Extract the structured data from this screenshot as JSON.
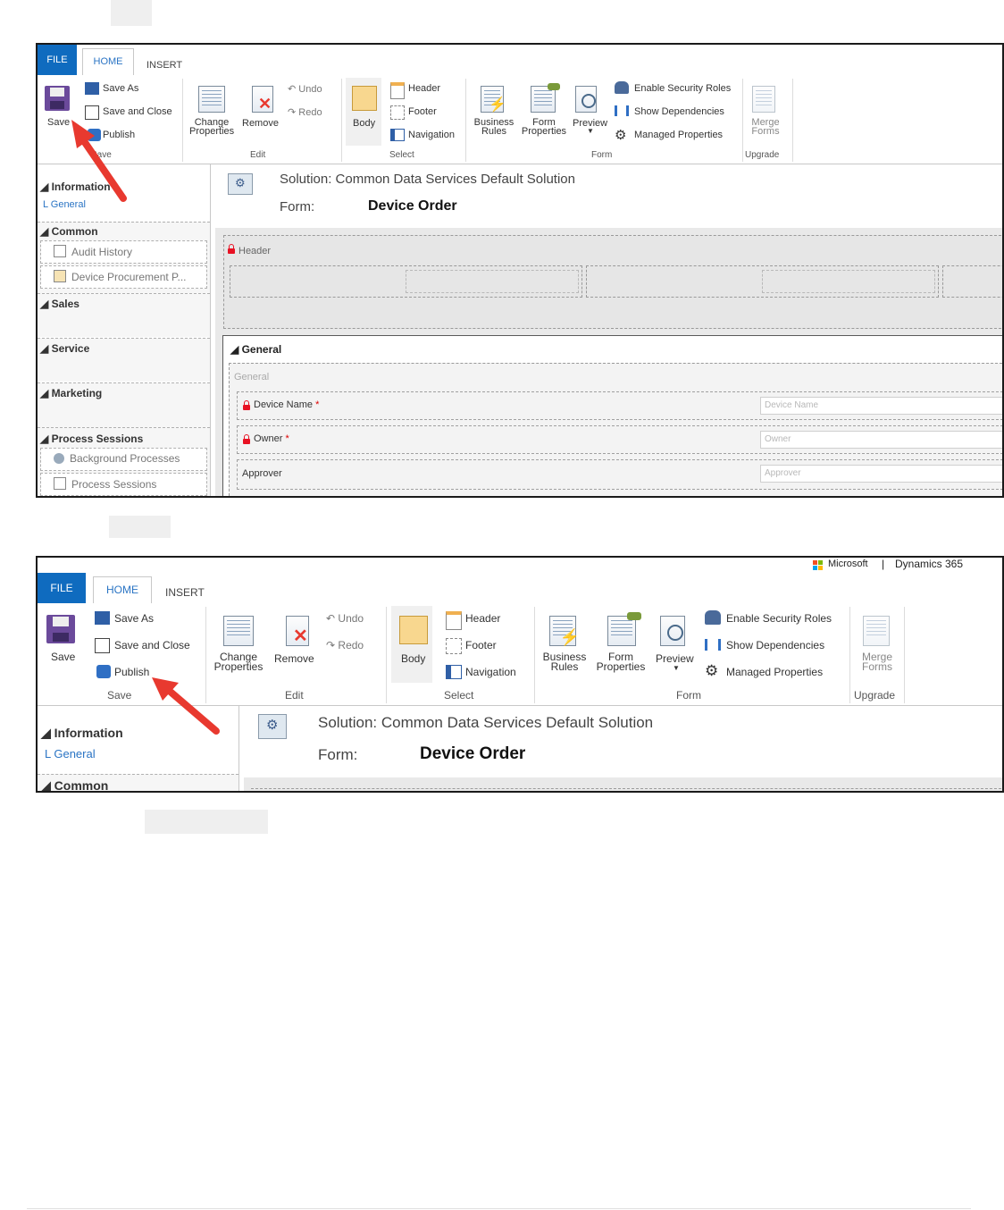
{
  "ribbon": {
    "tabs": {
      "file": "FILE",
      "home": "HOME",
      "insert": "INSERT"
    },
    "save_group": {
      "label": "Save",
      "save": "Save",
      "save_as": "Save As",
      "save_and_close": "Save and Close",
      "publish": "Publish"
    },
    "edit_group": {
      "label": "Edit",
      "change_properties_1": "Change",
      "change_properties_2": "Properties",
      "remove": "Remove",
      "undo": "Undo",
      "redo": "Redo"
    },
    "select_group": {
      "label": "Select",
      "body": "Body",
      "header": "Header",
      "footer": "Footer",
      "navigation": "Navigation"
    },
    "form_group": {
      "label": "Form",
      "business_rules_1": "Business",
      "business_rules_2": "Rules",
      "form_properties_1": "Form",
      "form_properties_2": "Properties",
      "preview": "Preview",
      "enable_security_roles": "Enable Security Roles",
      "show_dependencies": "Show Dependencies",
      "managed_properties": "Managed Properties"
    },
    "upgrade_group": {
      "label": "Upgrade",
      "merge_forms_1": "Merge",
      "merge_forms_2": "Forms"
    }
  },
  "branding": {
    "microsoft": "Microsoft",
    "separator": "|",
    "product": "Dynamics 365"
  },
  "nav": {
    "information": "Information",
    "general": "L  General",
    "common": "Common",
    "audit_history": "Audit History",
    "device_procurement": "Device Procurement P...",
    "sales": "Sales",
    "service": "Service",
    "marketing": "Marketing",
    "process_sessions": "Process Sessions",
    "background_processes": "Background Processes",
    "process_sessions_item": "Process Sessions"
  },
  "form": {
    "solution": "Solution: Common Data Services Default Solution",
    "form_label": "Form:",
    "form_name": "Device Order",
    "header_label": "Header",
    "general_tab": "General",
    "general_section": "General",
    "fields": [
      {
        "label": "Device Name",
        "required": "*",
        "placeholder": "Device Name"
      },
      {
        "label": "Owner",
        "required": "*",
        "placeholder": "Owner"
      },
      {
        "label": "Approver",
        "required": "",
        "placeholder": "Approver"
      }
    ]
  },
  "colors": {
    "file_tab": "#0f6bbf",
    "arrow": "#e8392f",
    "lock": "#e81123",
    "link": "#2a74c4"
  }
}
